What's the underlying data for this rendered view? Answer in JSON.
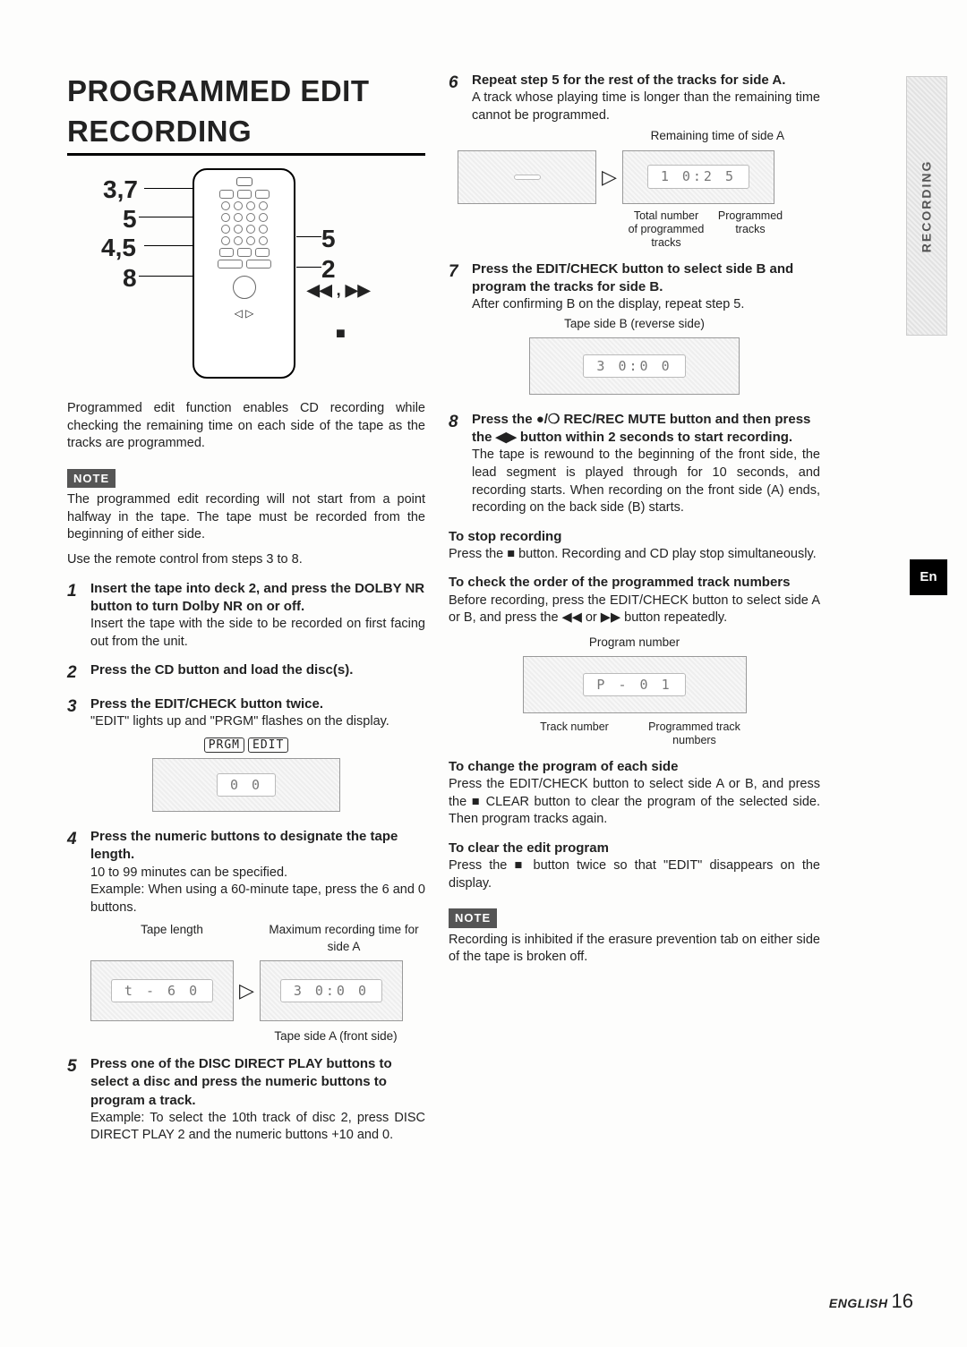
{
  "title": "PROGRAMMED EDIT RECORDING",
  "side_tab": "RECORDING",
  "en_badge": "En",
  "remote_callouts": {
    "a": "3,7",
    "b": "5",
    "c": "4,5",
    "d": "8",
    "e": "5",
    "f": "2",
    "g": "◀◀ , ▶▶",
    "stop": "■"
  },
  "intro": "Programmed edit function enables CD recording while checking the remaining time on each side of the tape as the tracks are programmed.",
  "note_label": "NOTE",
  "note1": "The programmed edit recording will not start from a point halfway in the tape. The tape must be recorded from the beginning of either side.",
  "remote_hint": "Use the remote control from steps 3 to 8.",
  "steps": {
    "s1_title": "Insert the tape into deck 2, and press the DOLBY NR button to turn Dolby NR on or off.",
    "s1_body": "Insert the tape with the side to be recorded on first facing out from the unit.",
    "s2_title": "Press the CD button and load the disc(s).",
    "s3_title": "Press the EDIT/CHECK button twice.",
    "s3_body": "\"EDIT\" lights up and \"PRGM\" flashes on the display.",
    "prgm": "PRGM",
    "edit": "EDIT",
    "s3_display": "0 0",
    "s4_title": "Press the numeric buttons to designate the tape length.",
    "s4_body1": "10 to 99 minutes can be specified.",
    "s4_body2": "Example: When using a 60-minute tape, press the 6 and 0 buttons.",
    "s4_lab_left": "Tape length",
    "s4_lab_right": "Maximum recording time for side A",
    "s4_disp_left": "t - 6 0",
    "s4_disp_right": "3 0:0 0",
    "s4_caption": "Tape side A (front side)",
    "s5_title": "Press one of the DISC DIRECT PLAY buttons to select a disc and press the numeric buttons to program a track.",
    "s5_body": "Example: To select the 10th track of disc 2, press DISC DIRECT PLAY 2 and the numeric buttons +10 and 0.",
    "s6_title": "Repeat step 5 for the rest of the tracks for side A.",
    "s6_body": "A track whose playing time is longer than the remaining time cannot be programmed.",
    "s6_lab_top": "Remaining time of side A",
    "s6_disp_left": "",
    "s6_disp_right": "1 0:2 5",
    "s6_lab_bl": "Total number of programmed tracks",
    "s6_lab_br": "Programmed tracks",
    "s7_title": "Press the EDIT/CHECK button to select side B and program the tracks for side B.",
    "s7_body": "After confirming B on the display, repeat step 5.",
    "s7_caption": "Tape side B (reverse side)",
    "s7_disp": "3 0:0 0",
    "s8_title": "Press the ●/❍ REC/REC MUTE button and then press the ◀▶ button within 2 seconds to start recording.",
    "s8_body": "The tape is rewound to the beginning of the front side, the lead segment is played through for 10 seconds, and recording starts. When recording on the front side (A) ends, recording on the back side (B) starts."
  },
  "extras": {
    "stop_head": "To stop recording",
    "stop_body": "Press the ■ button. Recording and CD play stop simultaneously.",
    "check_head": "To check the order of the programmed track numbers",
    "check_body": "Before recording, press the EDIT/CHECK button to select side A or B, and press the ◀◀ or ▶▶ button repeatedly.",
    "check_lab_top": "Program number",
    "check_disp": "P - 0 1",
    "check_lab_bl": "Track number",
    "check_lab_br": "Programmed track numbers",
    "change_head": "To change the program of each side",
    "change_body": "Press the EDIT/CHECK button to select side A or B, and press the ■ CLEAR button to clear the program of the selected side. Then program tracks again.",
    "clear_head": "To clear the edit program",
    "clear_body": "Press the ■ button twice so that \"EDIT\" disappears on the display.",
    "note2": "Recording is inhibited if the erasure prevention tab on either side of the tape is broken off."
  },
  "footer": {
    "lang": "ENGLISH",
    "page": "16"
  }
}
